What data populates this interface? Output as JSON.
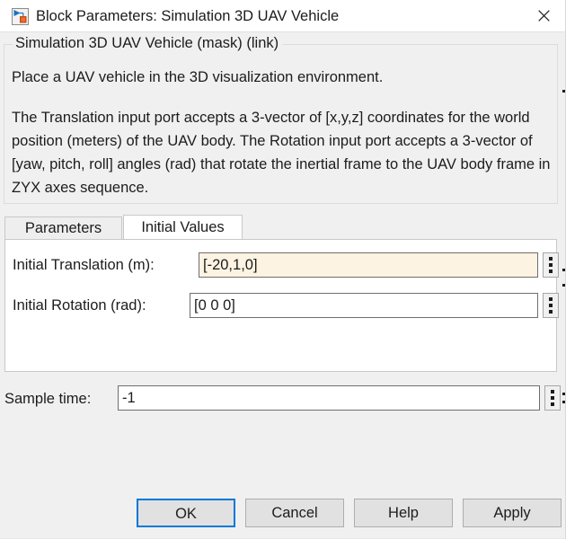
{
  "window": {
    "title": "Block Parameters: Simulation 3D UAV Vehicle",
    "icon": "simulink-block-icon",
    "close_icon": "close-icon",
    "accent_color": "#0078d7",
    "modified_field_color": "#fdf3e2"
  },
  "description": {
    "legend": "Simulation 3D UAV Vehicle (mask) (link)",
    "summary": "Place a UAV vehicle in the 3D visualization environment.",
    "detail": "The Translation input port accepts a 3-vector of [x,y,z] coordinates for the world position (meters) of the UAV body. The Rotation input port accepts a 3-vector of [yaw, pitch, roll] angles (rad) that rotate the inertial frame to the UAV body frame in ZYX axes sequence."
  },
  "tabs": [
    {
      "label": "Parameters",
      "active": false
    },
    {
      "label": "Initial Values",
      "active": true
    }
  ],
  "fields": [
    {
      "label": "Initial Translation (m):",
      "value": "[-20,1,0]",
      "placeholder": "",
      "modified": true,
      "menu_icon": "vertical-ellipsis-icon"
    },
    {
      "label": "Initial Rotation (rad):",
      "value": "[0 0 0]",
      "placeholder": "",
      "modified": false,
      "menu_icon": "vertical-ellipsis-icon"
    }
  ],
  "sample_time": {
    "label": "Sample time:",
    "value": "-1",
    "placeholder": "",
    "menu_icon": "vertical-ellipsis-icon"
  },
  "buttons": {
    "ok": "OK",
    "cancel": "Cancel",
    "help": "Help",
    "apply": "Apply"
  }
}
